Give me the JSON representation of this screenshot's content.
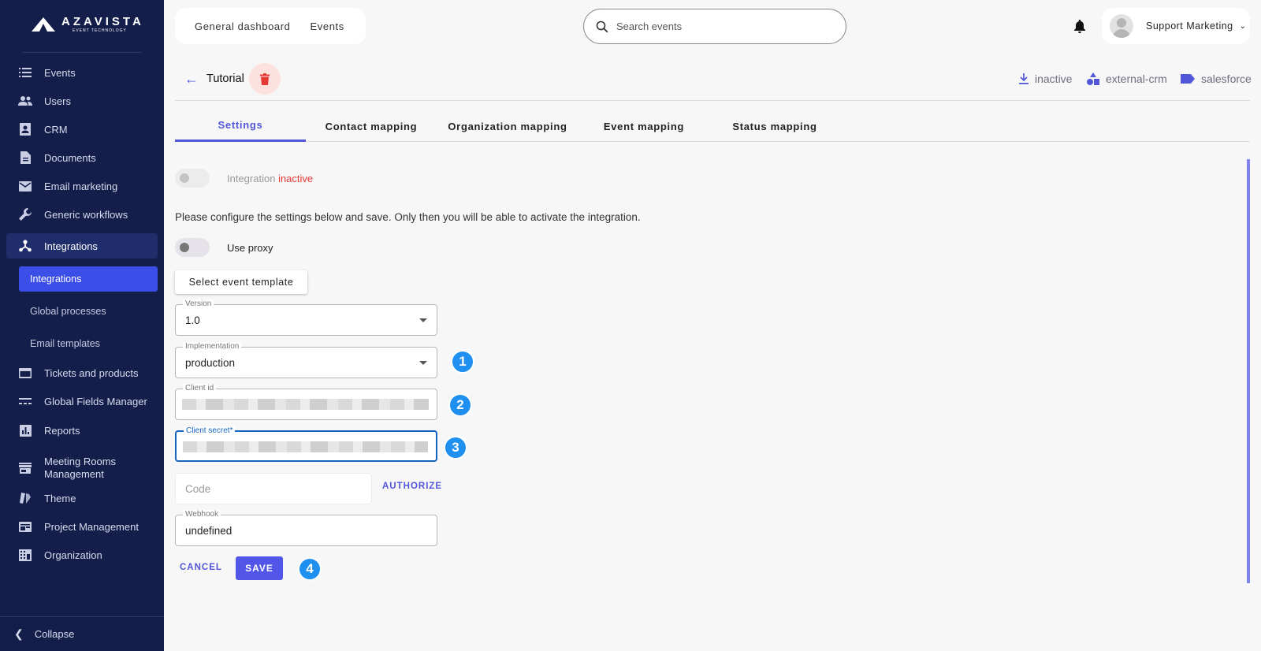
{
  "brand": {
    "name": "AZAVISTA",
    "sub": "EVENT TECHNOLOGY"
  },
  "sidebar": {
    "items": [
      {
        "label": "Events",
        "icon": "list-icon"
      },
      {
        "label": "Users",
        "icon": "users-icon"
      },
      {
        "label": "CRM",
        "icon": "contact-card-icon"
      },
      {
        "label": "Documents",
        "icon": "document-icon"
      },
      {
        "label": "Email marketing",
        "icon": "mail-icon"
      },
      {
        "label": "Generic workflows",
        "icon": "wrench-icon"
      },
      {
        "label": "Integrations",
        "icon": "hub-icon",
        "active": true
      },
      {
        "label": "Tickets and products",
        "icon": "card-icon"
      },
      {
        "label": "Global Fields Manager",
        "icon": "fields-icon"
      },
      {
        "label": "Reports",
        "icon": "chart-icon"
      },
      {
        "label": "Meeting Rooms Management",
        "icon": "store-icon"
      },
      {
        "label": "Theme",
        "icon": "palette-icon"
      },
      {
        "label": "Project Management",
        "icon": "board-icon"
      },
      {
        "label": "Organization",
        "icon": "building-icon"
      }
    ],
    "subitems": [
      {
        "label": "Integrations",
        "selected": true
      },
      {
        "label": "Global processes"
      },
      {
        "label": "Email templates"
      }
    ],
    "collapse": "Collapse"
  },
  "topbar": {
    "tabs": [
      "General dashboard",
      "Events"
    ],
    "search_placeholder": "Search events",
    "user_name": "Support Marketing"
  },
  "header": {
    "title": "Tutorial",
    "meta": [
      {
        "label": "inactive",
        "icon": "download-icon"
      },
      {
        "label": "external-crm",
        "icon": "shapes-icon"
      },
      {
        "label": "salesforce",
        "icon": "label-icon"
      }
    ]
  },
  "tabs": [
    "Settings",
    "Contact mapping",
    "Organization mapping",
    "Event mapping",
    "Status mapping"
  ],
  "form": {
    "integration_label": "Integration",
    "integration_status": "inactive",
    "info_text": "Please configure the settings below and save. Only then you will be able to activate the integration.",
    "use_proxy_label": "Use proxy",
    "template_button": "Select event template",
    "version_label": "Version",
    "version_value": "1.0",
    "implementation_label": "Implementation",
    "implementation_value": "production",
    "client_id_label": "Client id",
    "client_secret_label": "Client secret*",
    "code_placeholder": "Code",
    "authorize_label": "AUTHORIZE",
    "webhook_label": "Webhook",
    "webhook_value": "undefined",
    "cancel_label": "CANCEL",
    "save_label": "SAVE"
  },
  "annotations": [
    "1",
    "2",
    "3",
    "4"
  ],
  "colors": {
    "sidebar_bg": "#131e4b",
    "accent": "#5256d8",
    "selected": "#3b4fe8",
    "danger": "#e53935",
    "badge": "#1f8ff0"
  }
}
